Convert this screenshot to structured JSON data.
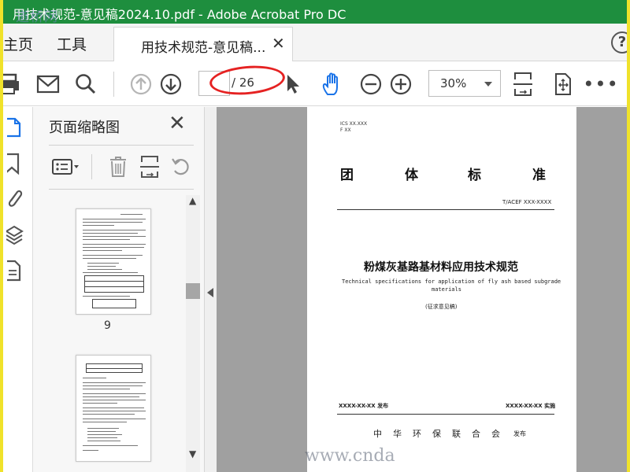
{
  "window": {
    "title": "用技术规范-意见稿2024.10.pdf - Adobe Acrobat Pro DC"
  },
  "watermark": {
    "top": "道桥网",
    "bottom": "www.cnda"
  },
  "nav": {
    "home": "主页",
    "tools": "工具",
    "doc_tab": "用技术规范-意见稿...",
    "help": "?"
  },
  "toolbar": {
    "page_current": "",
    "page_total": "/ 26",
    "zoom": "30%"
  },
  "panel": {
    "title": "页面缩略图",
    "thumbs": [
      {
        "label": "9"
      },
      {
        "label": ""
      }
    ]
  },
  "document": {
    "ics": "ICS XX.XXX",
    "class": "F XX",
    "heading_chars": [
      "团",
      "体",
      "标",
      "准"
    ],
    "code": "T/ACEF XXX-XXXX",
    "title_cn": "粉煤灰基路基材料应用技术规范",
    "title_en_1": "Technical specifications for application of fly ash based subgrade",
    "title_en_2": "materials",
    "draft": "(征求意见稿)",
    "issued": "XXXX-XX-XX 发布",
    "implemented": "XXXX-XX-XX 实施",
    "org_chars": [
      "中",
      "华",
      "环",
      "保",
      "联",
      "合",
      "会"
    ],
    "org_suffix": "发布"
  },
  "colors": {
    "title_bar": "#1e8e3e",
    "frame": "#f0e22a",
    "accent_hand": "#1a73e8",
    "annotation": "#e52222"
  }
}
